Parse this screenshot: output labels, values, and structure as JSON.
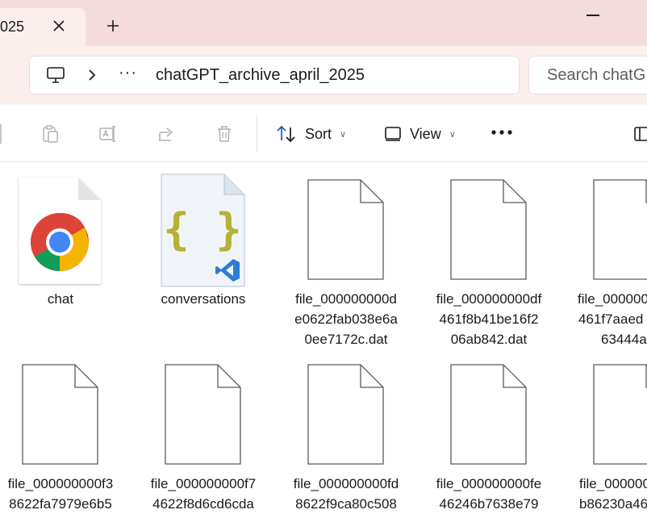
{
  "tab": {
    "title": "025"
  },
  "address": {
    "ellipsis": "···",
    "path": "chatGPT_archive_april_2025"
  },
  "search": {
    "placeholder": "Search chatG"
  },
  "toolbar": {
    "sort_label": "Sort",
    "view_label": "View"
  },
  "files": [
    {
      "icon": "chrome-icon",
      "lines": [
        "chat"
      ]
    },
    {
      "icon": "json-vscode-icon",
      "lines": [
        "conversations"
      ]
    },
    {
      "icon": "blank-file-icon",
      "lines": [
        "file_000000000d",
        "e0622fab038e6a",
        "0ee7172c.dat"
      ]
    },
    {
      "icon": "blank-file-icon",
      "lines": [
        "file_000000000df",
        "461f8b41be16f2",
        "06ab842.dat"
      ]
    },
    {
      "icon": "blank-file-icon",
      "lines": [
        "file_00000000",
        "461f7aaed",
        "63444a."
      ]
    },
    {
      "icon": "blank-file-icon",
      "lines": [
        "file_000000000f3",
        "8622fa7979e6b5"
      ]
    },
    {
      "icon": "blank-file-icon",
      "lines": [
        "file_000000000f7",
        "4622f8d6cd6cda"
      ]
    },
    {
      "icon": "blank-file-icon",
      "lines": [
        "file_000000000fd",
        "8622f9ca80c508"
      ]
    },
    {
      "icon": "blank-file-icon",
      "lines": [
        "file_000000000fe",
        "46246b7638e79"
      ]
    },
    {
      "icon": "blank-file-icon",
      "lines": [
        "file_00000000",
        "b86230a46"
      ]
    }
  ],
  "colors": {
    "titlebar": "#f4dcdc",
    "tab_active": "#fbefee",
    "vscode_blue": "#2b7cd3",
    "json_brace": "#b5b235"
  }
}
